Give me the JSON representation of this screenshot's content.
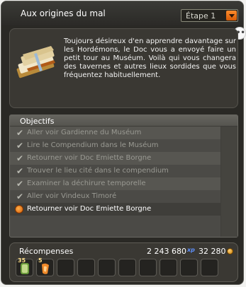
{
  "window": {
    "title": "Aux origines du mal",
    "step_selector": {
      "selected": "Étape 1"
    },
    "chat_icon": "speech-bubble-icon"
  },
  "description": {
    "text": "Toujours désireux d'en apprendre davantage sur les Hordémons, le Doc vous a envoyé faire un petit tour au Muséum. Voilà qui vous changera des tavernes et autres lieux sordides que vous fréquentez habituellement.",
    "icon": "book-icon"
  },
  "objectives": {
    "header": "Objectifs",
    "items": [
      {
        "label": "Aller voir Gardienne du Muséum",
        "done": true
      },
      {
        "label": "Lire le Compendium dans le Muséum",
        "done": true
      },
      {
        "label": "Retourner voir Doc Emiette Borgne",
        "done": true
      },
      {
        "label": "Trouver le lieu cité dans le compendium",
        "done": true
      },
      {
        "label": "Examiner la déchirure temporelle",
        "done": true
      },
      {
        "label": "Aller voir Vindeux Timoré",
        "done": true
      },
      {
        "label": "Retourner voir Doc Emiette Borgne",
        "done": false,
        "active": true
      }
    ],
    "done_icon": "checkmark-icon",
    "active_icon": "active-objective-icon"
  },
  "rewards": {
    "title": "Récompenses",
    "xp": "2 243 680",
    "xp_unit": "xp",
    "kamas": "32 280",
    "items": [
      {
        "qty": "35",
        "icon": "scroll-item-icon"
      },
      {
        "qty": "5",
        "icon": "orange-item-icon"
      }
    ],
    "empty_slots": 8
  },
  "colors": {
    "accent_orange": "#e8720c",
    "panel_bg": "#2a2925",
    "text": "#f3f3f3",
    "done_text": "#9a9a93",
    "xp_blue": "#5e91ff"
  }
}
